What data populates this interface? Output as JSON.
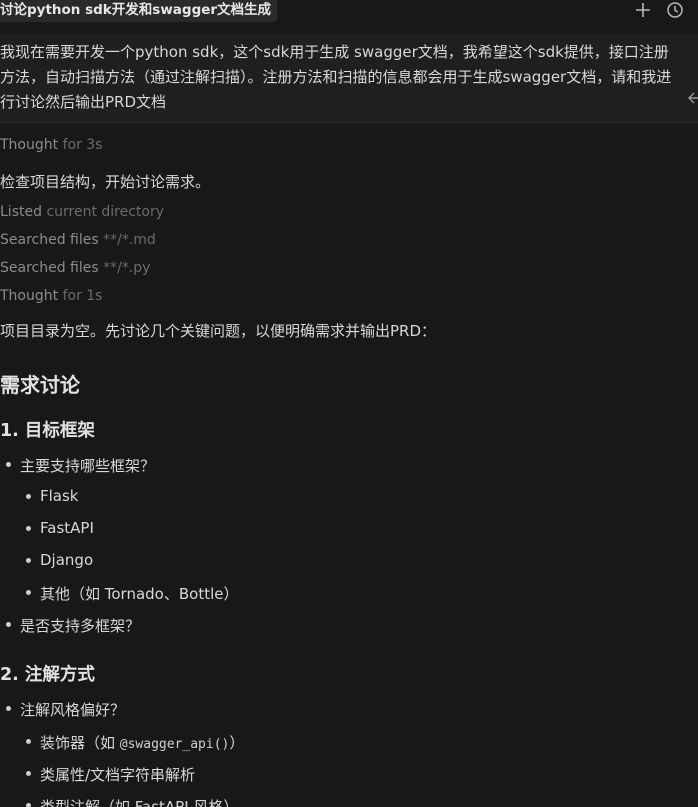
{
  "header": {
    "title": "讨论python sdk开发和swagger文档生成",
    "new_chat_icon": "plus-icon",
    "history_icon": "clock-icon"
  },
  "prompt": {
    "text": "我现在需要开发一个python sdk，这个sdk用于生成 swagger文档，我希望这个sdk提供，接口注册方法，自动扫描方法（通过注解扫描）。注册方法和扫描的信息都会用于生成swagger文档，请和我进行讨论然后输出PRD文档"
  },
  "activity": {
    "thought1": {
      "label": "Thought",
      "detail": "for 3s"
    },
    "msg1": "检查项目结构，开始讨论需求。",
    "listed": {
      "label": "Listed",
      "detail": "current directory"
    },
    "search_md": {
      "label": "Searched files",
      "detail": "**/*.md"
    },
    "search_py": {
      "label": "Searched files",
      "detail": "**/*.py"
    },
    "thought2": {
      "label": "Thought",
      "detail": "for 1s"
    },
    "msg2": "项目目录为空。先讨论几个关键问题，以便明确需求并输出PRD："
  },
  "content": {
    "h_discussion": "需求讨论",
    "s1_title": "1. 目标框架",
    "s1_q1": "主要支持哪些框架？",
    "s1_opts": [
      "Flask",
      "FastAPI",
      "Django",
      "其他（如 Tornado、Bottle）"
    ],
    "s1_q2": "是否支持多框架？",
    "s2_title": "2. 注解方式",
    "s2_q1": "注解风格偏好？",
    "s2_opt1_prefix": "装饰器（如 ",
    "s2_opt1_code": "@swagger_api()",
    "s2_opt1_suffix": "）",
    "s2_opt2": "类属性/文档字符串解析",
    "s2_opt3": "类型注解（如 FastAPI 风格）"
  },
  "colors": {
    "background": "#181818",
    "text": "#d8d8d8",
    "muted": "#8c8c8c"
  }
}
